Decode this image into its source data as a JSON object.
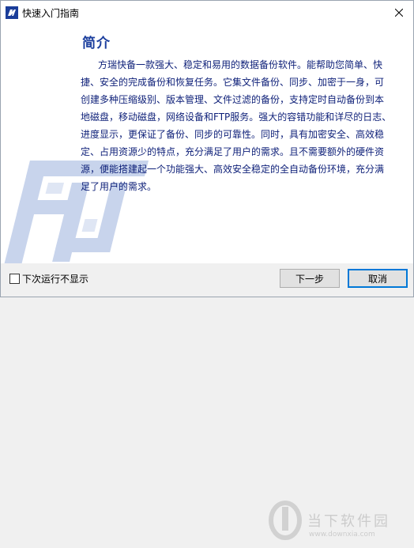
{
  "window": {
    "title": "快速入门指南",
    "close_icon": "close-icon"
  },
  "main": {
    "heading": "简介",
    "paragraph": "方瑞快备一款强大、稳定和易用的数据备份软件。能帮助您简单、快捷、安全的完成备份和恢复任务。它集文件备份、同步、加密于一身，可创建多种压缩级别、版本管理、文件过滤的备份，支持定时自动备份到本地磁盘，移动磁盘，网络设备和FTP服务。强大的容错功能和详尽的日志、进度显示，更保证了备份、同步的可靠性。同时，具有加密安全、高效稳定、占用资源少的特点，充分满足了用户的需求。且不需要额外的硬件资源，便能搭建起一个功能强大、高效安全稳定的全自动备份环境，充分满足了用户的需求。"
  },
  "footer": {
    "checkbox_label": "下次运行不显示",
    "checkbox_checked": false,
    "next_label": "下一步",
    "cancel_label": "取消"
  },
  "watermark": {
    "text": "当下软件园",
    "url": "www.downxia.com"
  },
  "colors": {
    "heading": "#1c3f9e",
    "body_text": "#0d1f78",
    "logo": "#c8d4ec"
  }
}
